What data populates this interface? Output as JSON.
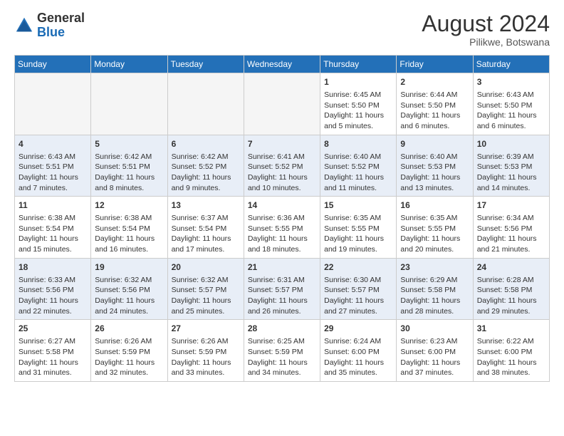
{
  "header": {
    "logo_general": "General",
    "logo_blue": "Blue",
    "month_year": "August 2024",
    "location": "Pilikwe, Botswana"
  },
  "days_of_week": [
    "Sunday",
    "Monday",
    "Tuesday",
    "Wednesday",
    "Thursday",
    "Friday",
    "Saturday"
  ],
  "weeks": [
    [
      {
        "day": "",
        "info": "",
        "empty": true
      },
      {
        "day": "",
        "info": "",
        "empty": true
      },
      {
        "day": "",
        "info": "",
        "empty": true
      },
      {
        "day": "",
        "info": "",
        "empty": true
      },
      {
        "day": "1",
        "info": "Sunrise: 6:45 AM\nSunset: 5:50 PM\nDaylight: 11 hours and 5 minutes.",
        "empty": false
      },
      {
        "day": "2",
        "info": "Sunrise: 6:44 AM\nSunset: 5:50 PM\nDaylight: 11 hours and 6 minutes.",
        "empty": false
      },
      {
        "day": "3",
        "info": "Sunrise: 6:43 AM\nSunset: 5:50 PM\nDaylight: 11 hours and 6 minutes.",
        "empty": false
      }
    ],
    [
      {
        "day": "4",
        "info": "Sunrise: 6:43 AM\nSunset: 5:51 PM\nDaylight: 11 hours and 7 minutes.",
        "empty": false
      },
      {
        "day": "5",
        "info": "Sunrise: 6:42 AM\nSunset: 5:51 PM\nDaylight: 11 hours and 8 minutes.",
        "empty": false
      },
      {
        "day": "6",
        "info": "Sunrise: 6:42 AM\nSunset: 5:52 PM\nDaylight: 11 hours and 9 minutes.",
        "empty": false
      },
      {
        "day": "7",
        "info": "Sunrise: 6:41 AM\nSunset: 5:52 PM\nDaylight: 11 hours and 10 minutes.",
        "empty": false
      },
      {
        "day": "8",
        "info": "Sunrise: 6:40 AM\nSunset: 5:52 PM\nDaylight: 11 hours and 11 minutes.",
        "empty": false
      },
      {
        "day": "9",
        "info": "Sunrise: 6:40 AM\nSunset: 5:53 PM\nDaylight: 11 hours and 13 minutes.",
        "empty": false
      },
      {
        "day": "10",
        "info": "Sunrise: 6:39 AM\nSunset: 5:53 PM\nDaylight: 11 hours and 14 minutes.",
        "empty": false
      }
    ],
    [
      {
        "day": "11",
        "info": "Sunrise: 6:38 AM\nSunset: 5:54 PM\nDaylight: 11 hours and 15 minutes.",
        "empty": false
      },
      {
        "day": "12",
        "info": "Sunrise: 6:38 AM\nSunset: 5:54 PM\nDaylight: 11 hours and 16 minutes.",
        "empty": false
      },
      {
        "day": "13",
        "info": "Sunrise: 6:37 AM\nSunset: 5:54 PM\nDaylight: 11 hours and 17 minutes.",
        "empty": false
      },
      {
        "day": "14",
        "info": "Sunrise: 6:36 AM\nSunset: 5:55 PM\nDaylight: 11 hours and 18 minutes.",
        "empty": false
      },
      {
        "day": "15",
        "info": "Sunrise: 6:35 AM\nSunset: 5:55 PM\nDaylight: 11 hours and 19 minutes.",
        "empty": false
      },
      {
        "day": "16",
        "info": "Sunrise: 6:35 AM\nSunset: 5:55 PM\nDaylight: 11 hours and 20 minutes.",
        "empty": false
      },
      {
        "day": "17",
        "info": "Sunrise: 6:34 AM\nSunset: 5:56 PM\nDaylight: 11 hours and 21 minutes.",
        "empty": false
      }
    ],
    [
      {
        "day": "18",
        "info": "Sunrise: 6:33 AM\nSunset: 5:56 PM\nDaylight: 11 hours and 22 minutes.",
        "empty": false
      },
      {
        "day": "19",
        "info": "Sunrise: 6:32 AM\nSunset: 5:56 PM\nDaylight: 11 hours and 24 minutes.",
        "empty": false
      },
      {
        "day": "20",
        "info": "Sunrise: 6:32 AM\nSunset: 5:57 PM\nDaylight: 11 hours and 25 minutes.",
        "empty": false
      },
      {
        "day": "21",
        "info": "Sunrise: 6:31 AM\nSunset: 5:57 PM\nDaylight: 11 hours and 26 minutes.",
        "empty": false
      },
      {
        "day": "22",
        "info": "Sunrise: 6:30 AM\nSunset: 5:57 PM\nDaylight: 11 hours and 27 minutes.",
        "empty": false
      },
      {
        "day": "23",
        "info": "Sunrise: 6:29 AM\nSunset: 5:58 PM\nDaylight: 11 hours and 28 minutes.",
        "empty": false
      },
      {
        "day": "24",
        "info": "Sunrise: 6:28 AM\nSunset: 5:58 PM\nDaylight: 11 hours and 29 minutes.",
        "empty": false
      }
    ],
    [
      {
        "day": "25",
        "info": "Sunrise: 6:27 AM\nSunset: 5:58 PM\nDaylight: 11 hours and 31 minutes.",
        "empty": false
      },
      {
        "day": "26",
        "info": "Sunrise: 6:26 AM\nSunset: 5:59 PM\nDaylight: 11 hours and 32 minutes.",
        "empty": false
      },
      {
        "day": "27",
        "info": "Sunrise: 6:26 AM\nSunset: 5:59 PM\nDaylight: 11 hours and 33 minutes.",
        "empty": false
      },
      {
        "day": "28",
        "info": "Sunrise: 6:25 AM\nSunset: 5:59 PM\nDaylight: 11 hours and 34 minutes.",
        "empty": false
      },
      {
        "day": "29",
        "info": "Sunrise: 6:24 AM\nSunset: 6:00 PM\nDaylight: 11 hours and 35 minutes.",
        "empty": false
      },
      {
        "day": "30",
        "info": "Sunrise: 6:23 AM\nSunset: 6:00 PM\nDaylight: 11 hours and 37 minutes.",
        "empty": false
      },
      {
        "day": "31",
        "info": "Sunrise: 6:22 AM\nSunset: 6:00 PM\nDaylight: 11 hours and 38 minutes.",
        "empty": false
      }
    ]
  ]
}
